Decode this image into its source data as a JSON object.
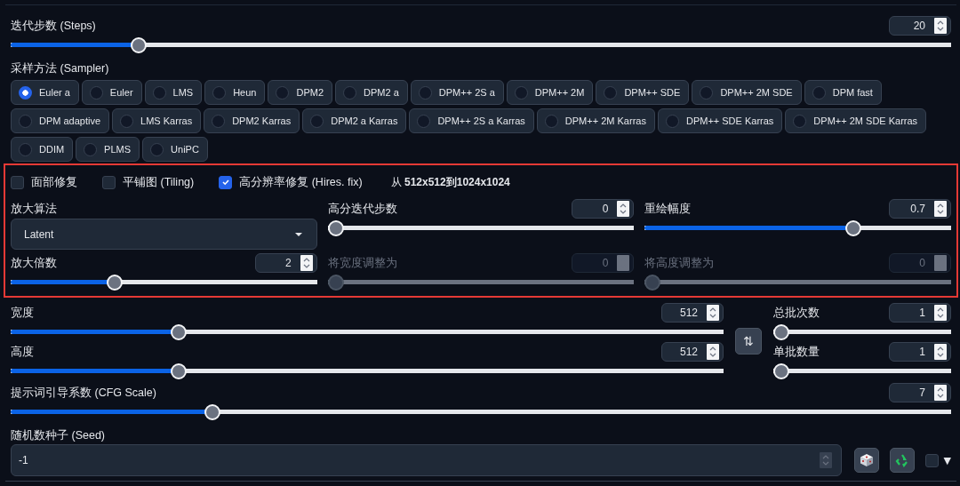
{
  "steps": {
    "label": "迭代步数 (Steps)",
    "value": "20",
    "level": 0.13
  },
  "sampler": {
    "label": "采样方法 (Sampler)",
    "options": [
      {
        "label": "Euler a",
        "selected": true
      },
      {
        "label": "Euler",
        "selected": false
      },
      {
        "label": "LMS",
        "selected": false
      },
      {
        "label": "Heun",
        "selected": false
      },
      {
        "label": "DPM2",
        "selected": false
      },
      {
        "label": "DPM2 a",
        "selected": false
      },
      {
        "label": "DPM++ 2S a",
        "selected": false
      },
      {
        "label": "DPM++ 2M",
        "selected": false
      },
      {
        "label": "DPM++ SDE",
        "selected": false
      },
      {
        "label": "DPM++ 2M SDE",
        "selected": false
      },
      {
        "label": "DPM fast",
        "selected": false
      },
      {
        "label": "DPM adaptive",
        "selected": false
      },
      {
        "label": "LMS Karras",
        "selected": false
      },
      {
        "label": "DPM2 Karras",
        "selected": false
      },
      {
        "label": "DPM2 a Karras",
        "selected": false
      },
      {
        "label": "DPM++ 2S a Karras",
        "selected": false
      },
      {
        "label": "DPM++ 2M Karras",
        "selected": false
      },
      {
        "label": "DPM++ SDE Karras",
        "selected": false
      },
      {
        "label": "DPM++ 2M SDE Karras",
        "selected": false
      },
      {
        "label": "DDIM",
        "selected": false
      },
      {
        "label": "PLMS",
        "selected": false
      },
      {
        "label": "UniPC",
        "selected": false
      }
    ]
  },
  "hires": {
    "toggles": [
      {
        "label": "面部修复",
        "checked": false
      },
      {
        "label": "平铺图 (Tiling)",
        "checked": false
      },
      {
        "label": "高分辨率修复 (Hires. fix)",
        "checked": true
      }
    ],
    "info": "从 **512x512到1024x1024**",
    "controls": [
      {
        "kind": "dropdown",
        "label": "放大算法",
        "value": "Latent"
      },
      {
        "kind": "slider",
        "label": "高分迭代步数",
        "value": "0",
        "level": 0,
        "disabled": false
      },
      {
        "kind": "slider",
        "label": "重绘幅度",
        "value": "0.7",
        "level": 0.69,
        "disabled": false
      },
      {
        "kind": "slider",
        "label": "放大倍数",
        "value": "2",
        "level": 0.33,
        "disabled": false
      },
      {
        "kind": "slider",
        "label": "将宽度调整为",
        "value": "0",
        "level": 0,
        "disabled": true
      },
      {
        "kind": "slider",
        "label": "将高度调整为",
        "value": "0",
        "level": 0,
        "disabled": true
      }
    ]
  },
  "size": [
    {
      "label": "宽度",
      "value": "512",
      "level": 0.23
    },
    {
      "label": "高度",
      "value": "512",
      "level": 0.23
    }
  ],
  "swap_button": "⇅",
  "batch": [
    {
      "label": "总批次数",
      "value": "1",
      "level": 0
    },
    {
      "label": "单批数量",
      "value": "1",
      "level": 0
    }
  ],
  "cfg": {
    "label": "提示词引导系数 (CFG Scale)",
    "value": "7",
    "level": 0.21
  },
  "seed": {
    "label": "随机数种子 (Seed)",
    "value": "-1",
    "option_checkbox": {
      "checked": false
    },
    "extra_toggle": "▼"
  }
}
